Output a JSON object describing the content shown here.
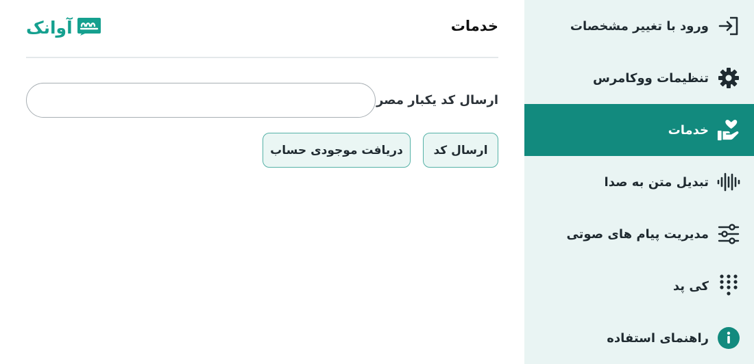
{
  "sidebar": {
    "items": [
      {
        "label": "ورود با تغییر مشخصات",
        "icon": "login-icon",
        "active": false
      },
      {
        "label": "تنظیمات ووکامرس",
        "icon": "gear-icon",
        "active": false
      },
      {
        "label": "خدمات",
        "icon": "hand-heart-icon",
        "active": true
      },
      {
        "label": "تبدیل متن به صدا",
        "icon": "waveform-icon",
        "active": false
      },
      {
        "label": "مدیریت پیام های صوتی",
        "icon": "sliders-icon",
        "active": false
      },
      {
        "label": "کی پد",
        "icon": "keypad-icon",
        "active": false
      },
      {
        "label": "راهنمای استفاده",
        "icon": "info-icon",
        "active": false
      }
    ]
  },
  "header": {
    "title": "خدمات",
    "logo_text": "آوانک"
  },
  "form": {
    "otp_label": "ارسال کد یکبار مصرف",
    "otp_value": "",
    "send_button": "ارسال کد",
    "balance_button": "دریافت موجودی حساب"
  },
  "colors": {
    "accent": "#128a7e",
    "sidebar_bg": "#e9f4f3",
    "button_bg": "#eaf6f4",
    "button_border": "#54b1a6",
    "logo": "#15a08f"
  }
}
